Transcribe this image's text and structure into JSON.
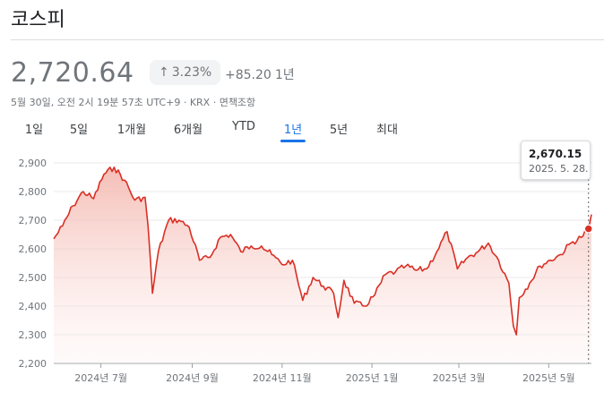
{
  "title": "코스피",
  "price": "2,720.64",
  "change_pct": "3.23%",
  "change_abs": "+85.20",
  "change_period": "1년",
  "meta": "5월 30일, 오전 2시 19분 57초 UTC+9 · KRX · 면책조항",
  "tabs": [
    "1일",
    "5일",
    "1개월",
    "6개월",
    "YTD",
    "1년",
    "5년",
    "최대"
  ],
  "active_tab": "1년",
  "colors": {
    "line": "#d93025",
    "accent": "#1a73e8",
    "fill": "#fce8e6"
  },
  "tooltip": {
    "value": "2,670.15",
    "date": "2025. 5. 28."
  },
  "chart_data": {
    "type": "area",
    "ylim": [
      2200,
      2900
    ],
    "y_ticks": [
      "2,900",
      "2,800",
      "2,700",
      "2,600",
      "2,500",
      "2,400",
      "2,300",
      "2,200"
    ],
    "x_ticks": [
      "2024년 7월",
      "2024년 9월",
      "2024년 11월",
      "2025년 1월",
      "2025년 3월",
      "2025년 5월"
    ],
    "x": [
      "2024-05-30",
      "2024-06-05",
      "2024-06-12",
      "2024-06-19",
      "2024-06-26",
      "2024-07-03",
      "2024-07-10",
      "2024-07-17",
      "2024-07-24",
      "2024-07-31",
      "2024-08-02",
      "2024-08-05",
      "2024-08-09",
      "2024-08-16",
      "2024-08-23",
      "2024-08-30",
      "2024-09-06",
      "2024-09-13",
      "2024-09-20",
      "2024-09-27",
      "2024-10-04",
      "2024-10-11",
      "2024-10-18",
      "2024-10-25",
      "2024-11-01",
      "2024-11-08",
      "2024-11-15",
      "2024-11-22",
      "2024-11-29",
      "2024-12-06",
      "2024-12-09",
      "2024-12-13",
      "2024-12-20",
      "2024-12-27",
      "2025-01-03",
      "2025-01-10",
      "2025-01-17",
      "2025-01-24",
      "2025-01-31",
      "2025-02-07",
      "2025-02-14",
      "2025-02-21",
      "2025-02-28",
      "2025-03-07",
      "2025-03-14",
      "2025-03-21",
      "2025-03-28",
      "2025-04-04",
      "2025-04-07",
      "2025-04-09",
      "2025-04-11",
      "2025-04-18",
      "2025-04-25",
      "2025-05-02",
      "2025-05-09",
      "2025-05-16",
      "2025-05-23",
      "2025-05-28",
      "2025-05-30"
    ],
    "series": [
      {
        "values": [
          2635,
          2680,
          2750,
          2800,
          2775,
          2860,
          2885,
          2840,
          2770,
          2780,
          2680,
          2445,
          2590,
          2700,
          2700,
          2675,
          2560,
          2570,
          2640,
          2650,
          2590,
          2610,
          2610,
          2580,
          2545,
          2560,
          2420,
          2500,
          2470,
          2445,
          2360,
          2490,
          2410,
          2400,
          2440,
          2510,
          2520,
          2540,
          2525,
          2530,
          2590,
          2660,
          2530,
          2570,
          2590,
          2620,
          2560,
          2480,
          2330,
          2300,
          2430,
          2480,
          2540,
          2560,
          2580,
          2620,
          2640,
          2670,
          2720
        ]
      }
    ]
  }
}
